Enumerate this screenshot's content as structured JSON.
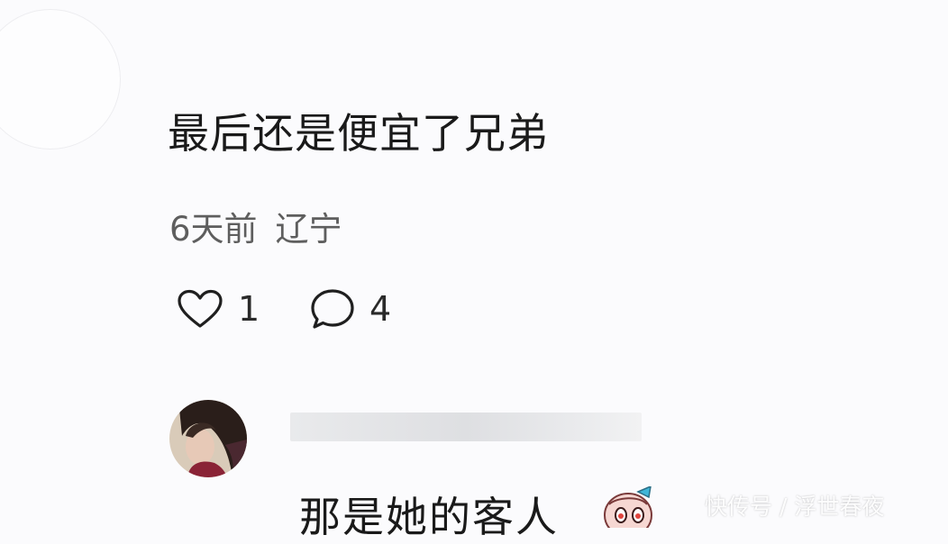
{
  "comment": {
    "text": "最后还是便宜了兄弟",
    "time": "6天前",
    "location": "辽宁",
    "like_count": "1",
    "reply_count": "4",
    "icons": {
      "like": "heart-outline-icon",
      "reply": "speech-bubble-icon"
    }
  },
  "reply": {
    "text": "那是她的客人",
    "emoji": "cartoon-face-emoji"
  },
  "watermark": "快传号 / 浮世春夜",
  "colors": {
    "background": "#fbfbfd",
    "text": "#1a1a1a",
    "meta": "#5e5e5e"
  }
}
